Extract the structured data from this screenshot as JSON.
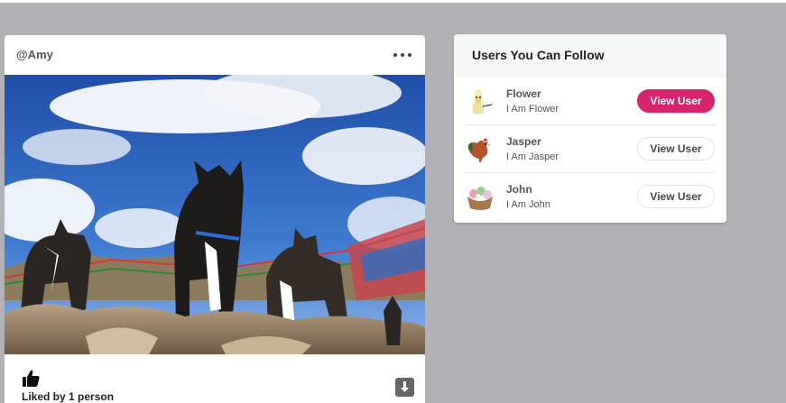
{
  "post": {
    "username": "@Amy",
    "more_icon": "ellipsis-horizontal-icon",
    "like_icon": "thumbs-up-icon",
    "likes_text": "Liked by 1 person",
    "download_icon": "download-arrow-icon"
  },
  "follow_panel": {
    "title": "Users You Can Follow",
    "users": [
      {
        "name": "Flower",
        "bio": "I Am Flower",
        "button_label": "View User",
        "button_active": true,
        "avatar_icon": "flower-pot-avatar-icon"
      },
      {
        "name": "Jasper",
        "bio": "I Am Jasper",
        "button_label": "View User",
        "button_active": false,
        "avatar_icon": "rooster-avatar-icon"
      },
      {
        "name": "John",
        "bio": "I Am John",
        "button_label": "View User",
        "button_active": false,
        "avatar_icon": "flower-basket-avatar-icon"
      }
    ]
  },
  "colors": {
    "page_background": "#b2b1b6",
    "accent": "#d7246e",
    "card_background": "#ffffff"
  }
}
